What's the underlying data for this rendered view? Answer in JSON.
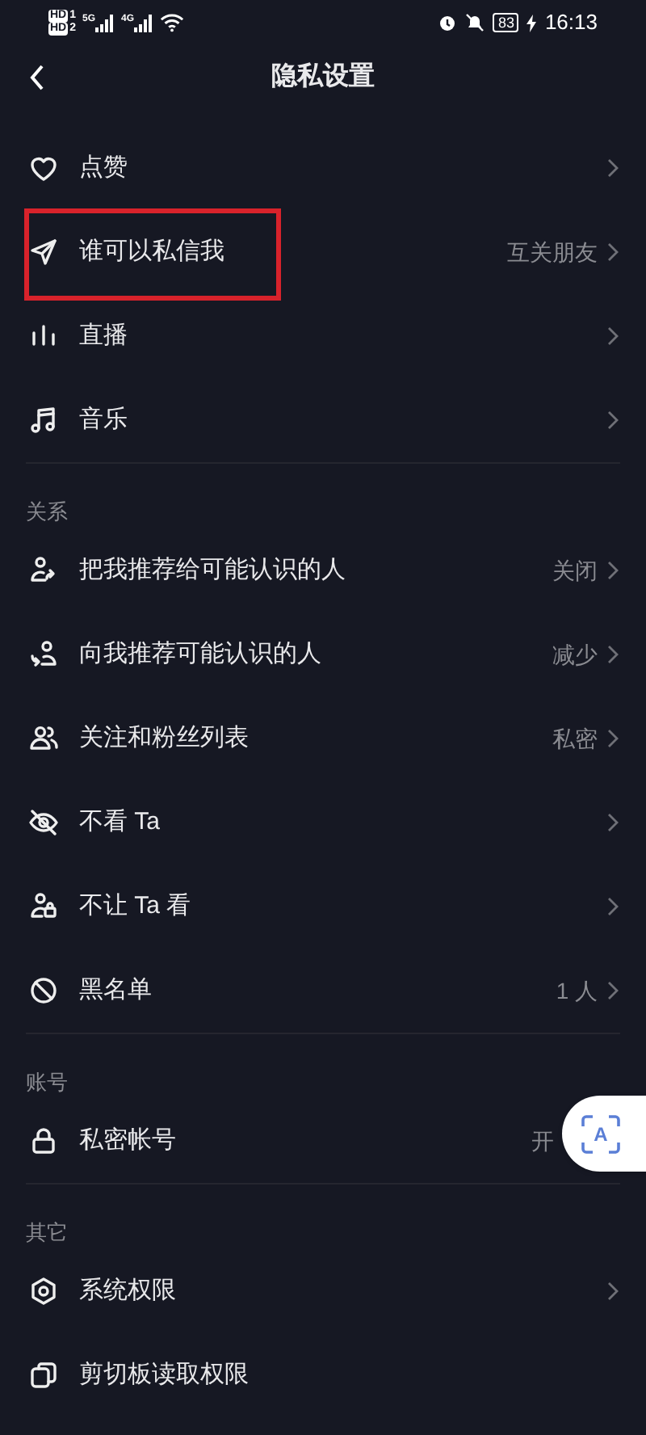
{
  "status_bar": {
    "sim1": "HD",
    "sim1_index": "1",
    "sim2": "HD",
    "sim2_index": "2",
    "network1": "5G",
    "network2": "4G",
    "battery": "83",
    "time": "16:13"
  },
  "header": {
    "title": "隐私设置"
  },
  "sections": [
    {
      "items": [
        {
          "kind": "heart",
          "label": "点赞",
          "chevron": true,
          "highlighted": false
        },
        {
          "kind": "send",
          "label": "谁可以私信我",
          "value": "互关朋友",
          "chevron": true,
          "highlighted": true
        },
        {
          "kind": "bars",
          "label": "直播",
          "chevron": true,
          "highlighted": false
        },
        {
          "kind": "music",
          "label": "音乐",
          "chevron": true,
          "highlighted": false
        }
      ]
    },
    {
      "title": "关系",
      "items": [
        {
          "kind": "person-share",
          "label": "把我推荐给可能认识的人",
          "value": "关闭",
          "chevron": true,
          "highlighted": false
        },
        {
          "kind": "person-in",
          "label": "向我推荐可能认识的人",
          "value": "减少",
          "chevron": true,
          "highlighted": false
        },
        {
          "kind": "people",
          "label": "关注和粉丝列表",
          "value": "私密",
          "chevron": true,
          "highlighted": false
        },
        {
          "kind": "eye-off",
          "label": "不看 Ta",
          "chevron": true,
          "highlighted": false
        },
        {
          "kind": "person-lock",
          "label": "不让 Ta 看",
          "chevron": true,
          "highlighted": false
        },
        {
          "kind": "ban",
          "label": "黑名单",
          "value": "1 人",
          "chevron": true,
          "highlighted": false
        }
      ]
    },
    {
      "title": "账号",
      "items": [
        {
          "kind": "lock",
          "label": "私密帐号",
          "value": "开",
          "chevron": false,
          "highlighted": false
        }
      ]
    },
    {
      "title": "其它",
      "items": [
        {
          "kind": "hexagon",
          "label": "系统权限",
          "chevron": true,
          "highlighted": false
        },
        {
          "kind": "copy",
          "label": "剪切板读取权限",
          "chevron": false,
          "highlighted": false
        }
      ]
    }
  ],
  "floating_button": {
    "label": "A"
  }
}
